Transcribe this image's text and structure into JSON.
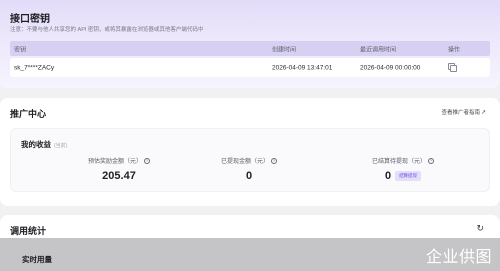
{
  "api": {
    "title": "接口密钥",
    "notice": "注意：不要与他人共享您的 API 密钥，或将其暴露在浏览器或其他客户端代码中",
    "columns": [
      "密钥",
      "创建时间",
      "最近调用时间",
      "操作"
    ],
    "rows": [
      {
        "key": "sk_7****ZACy",
        "created": "2026-04-09 13:47:01",
        "last_called": "2026-04-09 00:00:00",
        "action_icon": "copy-icon"
      }
    ]
  },
  "promo": {
    "title": "推广中心",
    "link": "查看推广者指南",
    "link_icon": "↗",
    "earnings": {
      "title": "我的收益",
      "subtitle": "(当前)",
      "stats": [
        {
          "label": "预估奖励金额（元）",
          "value": "205.47"
        },
        {
          "label": "已提现金额（元）",
          "value": "0"
        },
        {
          "label": "已结算待提现（元）",
          "value": "0",
          "button": "结算提现"
        }
      ]
    }
  },
  "stats": {
    "title": "调用统计",
    "refresh_icon": "refresh-icon",
    "realtime_title": "实时用量"
  },
  "watermark": "企业供图",
  "colors": {
    "accent": "#6b4fd8",
    "header_bg": "#e3dcf9"
  }
}
